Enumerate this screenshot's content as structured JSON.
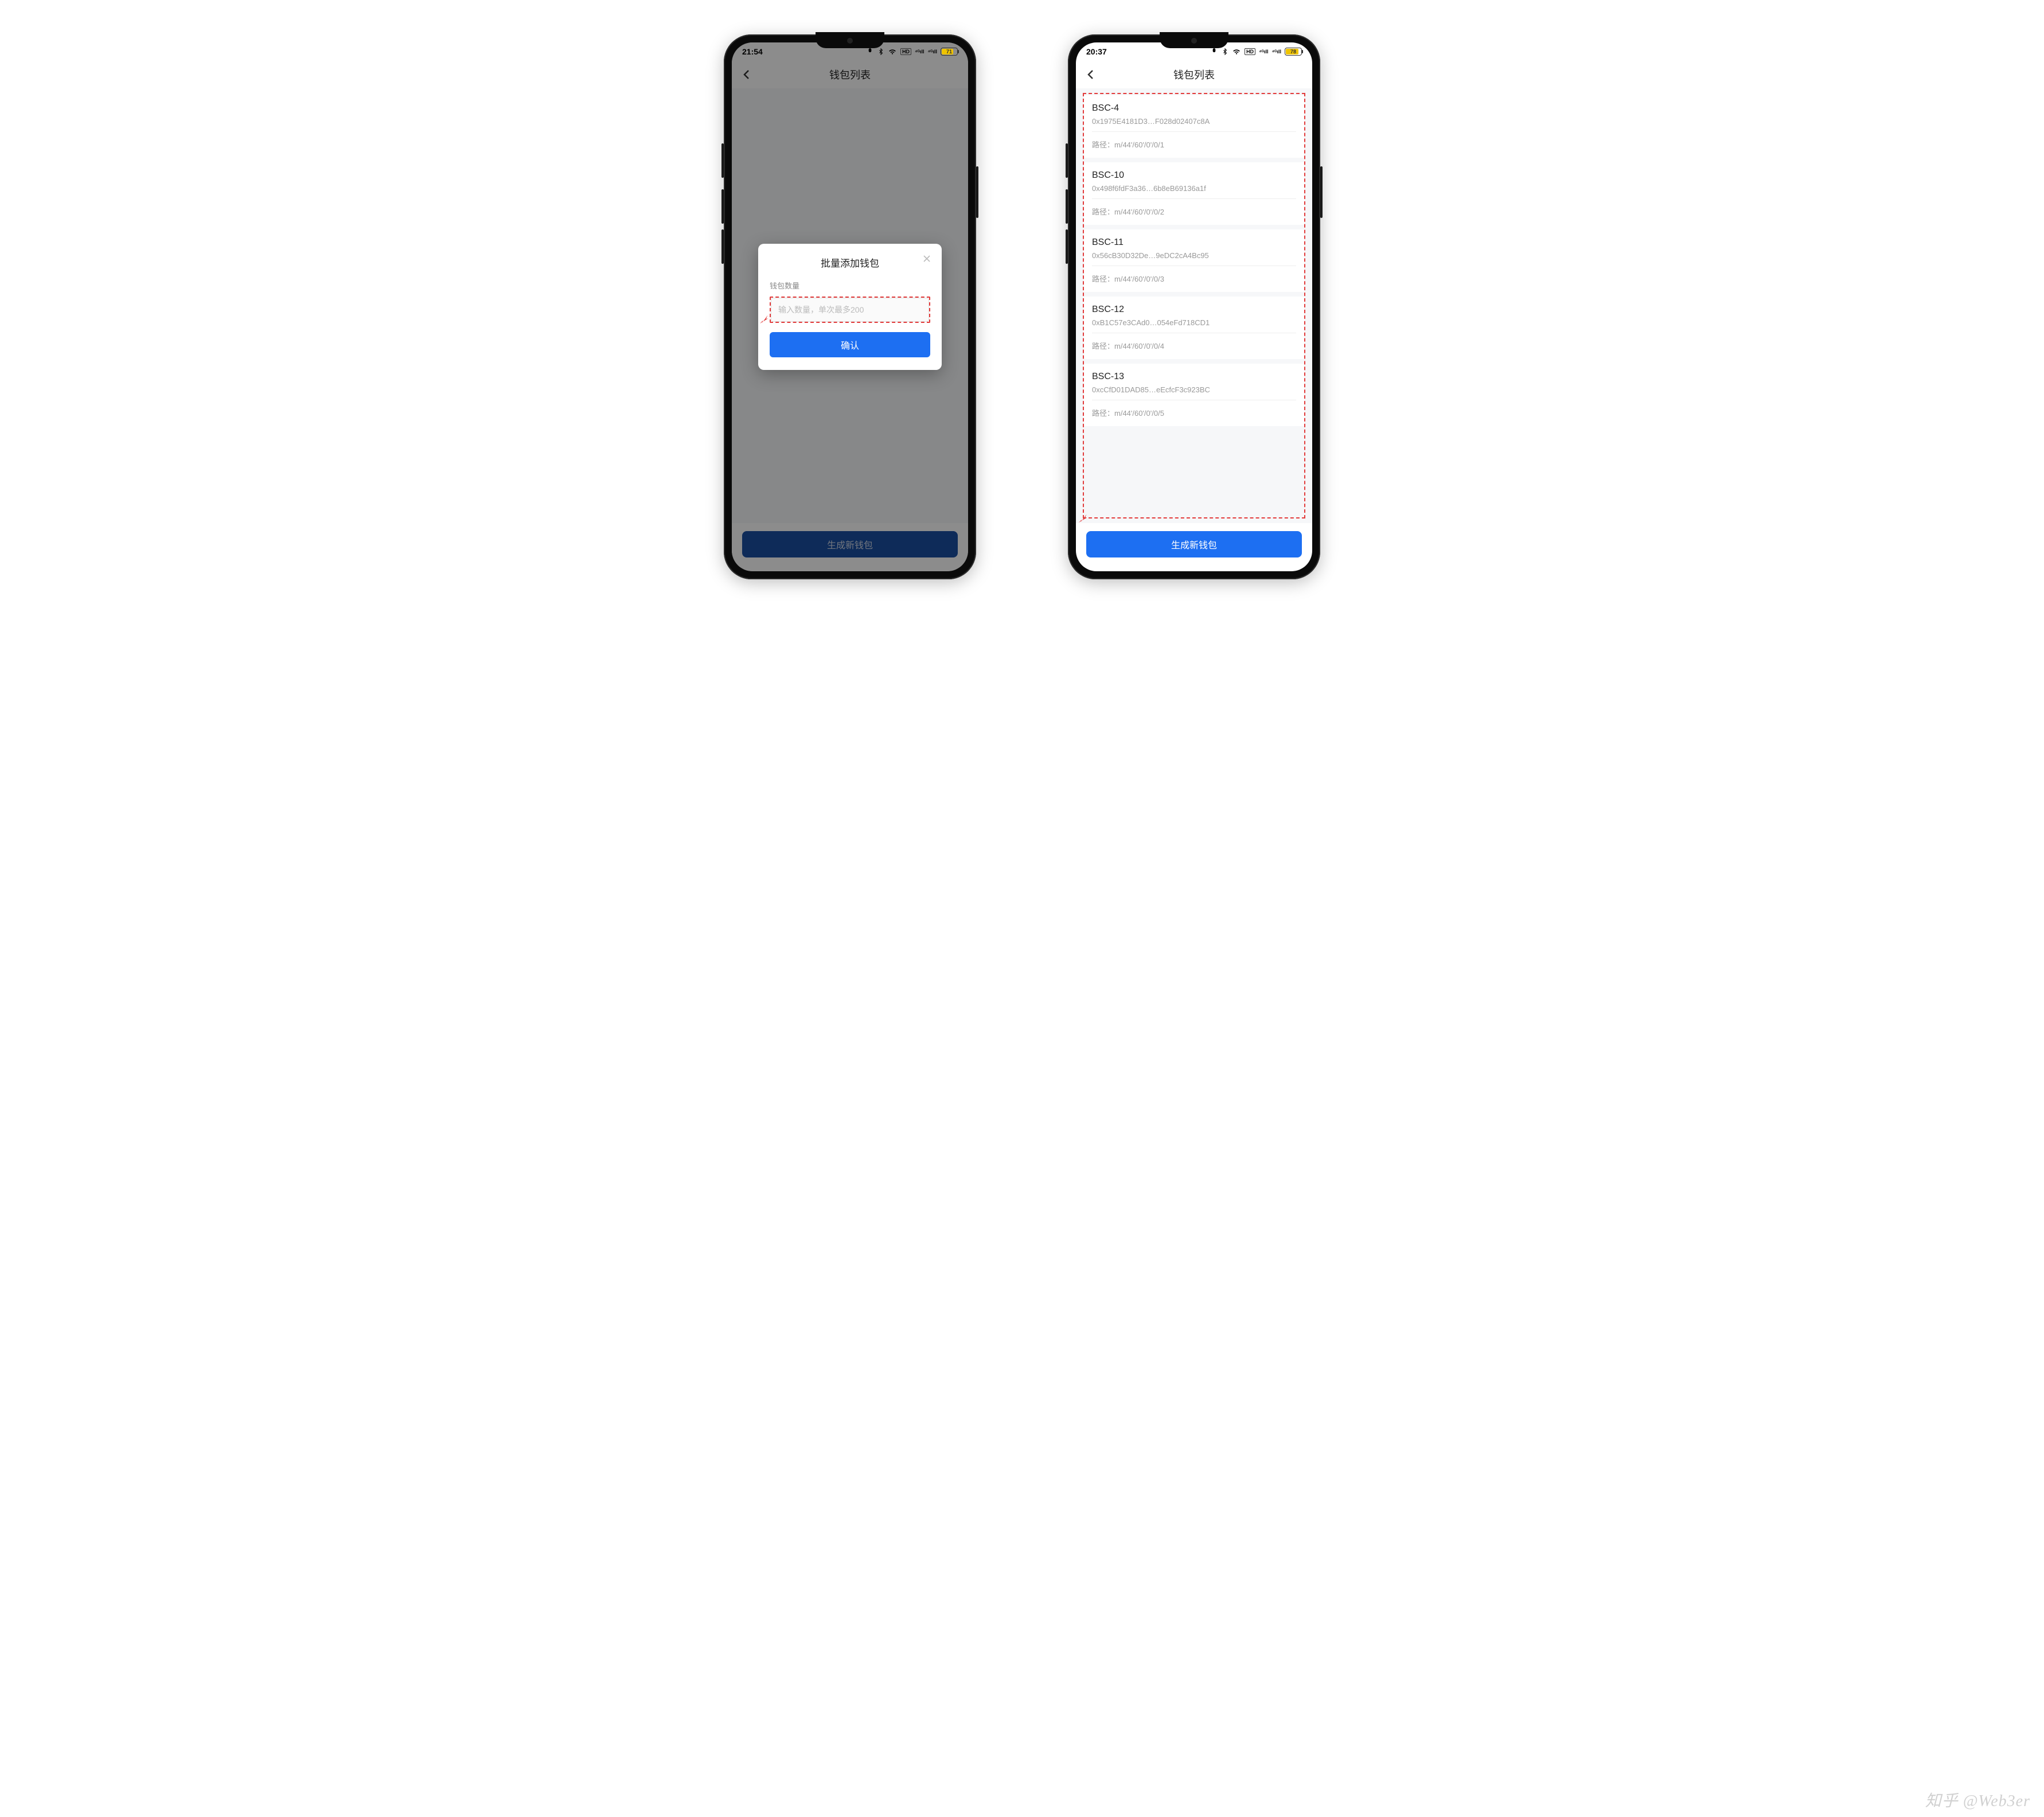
{
  "watermark": "知乎 @Web3er",
  "phone1": {
    "status": {
      "time": "21:54",
      "battery_pct": 71,
      "battery_label": "71"
    },
    "header": {
      "title": "钱包列表"
    },
    "bottom_button": "生成新钱包",
    "modal": {
      "title": "批量添加钱包",
      "field_label": "钱包数量",
      "placeholder": "输入数量，单次最多200",
      "confirm": "确认"
    }
  },
  "phone2": {
    "status": {
      "time": "20:37",
      "battery_pct": 78,
      "battery_label": "78"
    },
    "header": {
      "title": "钱包列表"
    },
    "bottom_button": "生成新钱包",
    "path_prefix": "路径：",
    "wallets": [
      {
        "name": "BSC-4",
        "address": "0x1975E4181D3…F028d02407c8A",
        "path": "m/44'/60'/0'/0/1"
      },
      {
        "name": "BSC-10",
        "address": "0x498f6fdF3a36…6b8eB69136a1f",
        "path": "m/44'/60'/0'/0/2"
      },
      {
        "name": "BSC-11",
        "address": "0x56cB30D32De…9eDC2cA4Bc95",
        "path": "m/44'/60'/0'/0/3"
      },
      {
        "name": "BSC-12",
        "address": "0xB1C57e3CAd0…054eFd718CD1",
        "path": "m/44'/60'/0'/0/4"
      },
      {
        "name": "BSC-13",
        "address": "0xcCfD01DAD85…eEcfcF3c923BC",
        "path": "m/44'/60'/0'/0/5"
      }
    ]
  }
}
